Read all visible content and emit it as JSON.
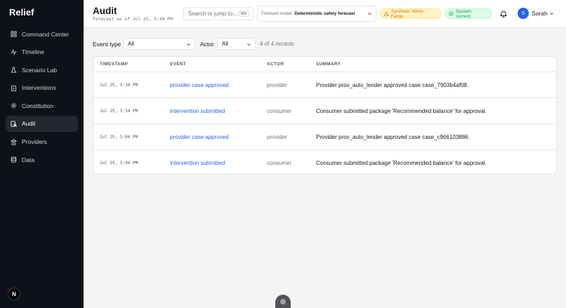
{
  "app": {
    "brand": "Relief",
    "badge": "N"
  },
  "sidebar": {
    "items": [
      {
        "label": "Command Center",
        "icon": "grid-icon"
      },
      {
        "label": "Timeline",
        "icon": "activity-icon"
      },
      {
        "label": "Scenario Lab",
        "icon": "flask-icon"
      },
      {
        "label": "Interventions",
        "icon": "clipboard-icon"
      },
      {
        "label": "Constitution",
        "icon": "settings-icon"
      },
      {
        "label": "Audit",
        "icon": "audit-icon",
        "active": true
      },
      {
        "label": "Providers",
        "icon": "bank-icon"
      },
      {
        "label": "Data",
        "icon": "database-icon"
      }
    ]
  },
  "header": {
    "title": "Audit",
    "subtitle": "Forecast as of Jul 25, 5:44 PM",
    "search_placeholder": "Search or jump to...",
    "search_shortcut": "⌘K",
    "forecast_label": "Forecast model",
    "forecast_value": "Deterministic safety forecast",
    "warning_pill": "Synthetic Wells Fargo",
    "status_pill": "System current",
    "user_initial": "S",
    "user_name": "Sarah"
  },
  "filters": {
    "event_type_label": "Event type",
    "event_type_value": "All",
    "actor_label": "Actor",
    "actor_value": "All",
    "records": "4 of 4 records"
  },
  "table": {
    "headers": {
      "timestamp": "TIMESTAMP",
      "event": "EVENT",
      "actor": "ACTOR",
      "summary": "SUMMARY"
    },
    "rows": [
      {
        "timestamp": "Jul 25, 5:34 PM",
        "event": "provider case approved",
        "actor": "provider",
        "summary": "Provider prov_auto_lender approved case case_7903b4af08."
      },
      {
        "timestamp": "Jul 25, 5:34 PM",
        "event": "intervention submitted",
        "actor": "consumer",
        "summary": "Consumer submitted package 'Recommended balance' for approval."
      },
      {
        "timestamp": "Jul 25, 5:04 PM",
        "event": "provider case approved",
        "actor": "provider",
        "summary": "Provider prov_auto_lender approved case case_c966103886."
      },
      {
        "timestamp": "Jul 25, 5:04 PM",
        "event": "intervention submitted",
        "actor": "consumer",
        "summary": "Consumer submitted package 'Recommended balance' for approval."
      }
    ]
  },
  "colors": {
    "sidebar_bg": "#0e1117",
    "accent": "#2563eb",
    "warning": "#d97706",
    "success": "#16a34a"
  }
}
